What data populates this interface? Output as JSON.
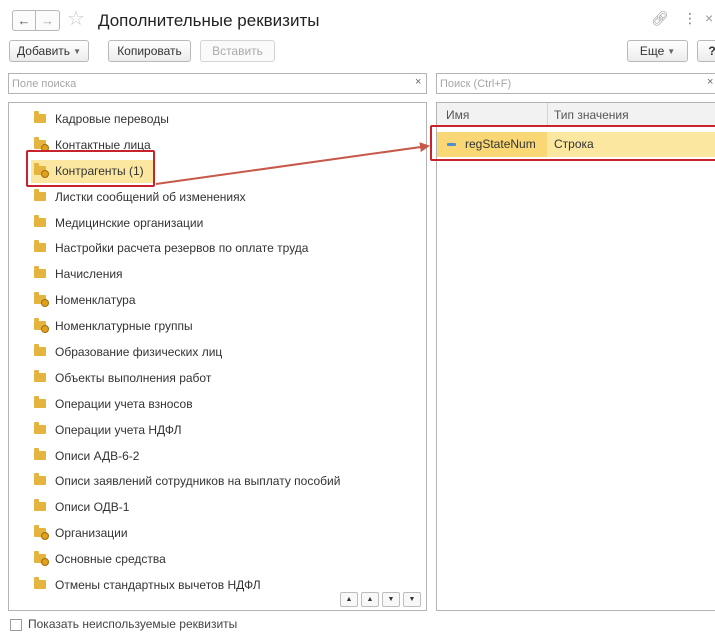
{
  "window": {
    "title": "Дополнительные реквизиты",
    "back_glyph": "←",
    "forward_glyph": "→",
    "icons": [
      "star-icon",
      "link-icon",
      "more-icon",
      "close-icon"
    ]
  },
  "toolbar": {
    "add_label": "Добавить",
    "copy_label": "Копировать",
    "paste_label": "Вставить",
    "more_label": "Еще",
    "help_label": "?"
  },
  "search_left": {
    "placeholder": "Поле поиска"
  },
  "search_right": {
    "placeholder": "Поиск (Ctrl+F)"
  },
  "tree": {
    "items": [
      {
        "label": "Кадровые переводы",
        "badge": false
      },
      {
        "label": "Контактные лица",
        "badge": true
      },
      {
        "label": "Контрагенты (1)",
        "badge": true,
        "selected": true
      },
      {
        "label": "Листки сообщений об изменениях",
        "badge": false
      },
      {
        "label": "Медицинские организации",
        "badge": false
      },
      {
        "label": "Настройки расчета резервов по оплате труда",
        "badge": false
      },
      {
        "label": "Начисления",
        "badge": false
      },
      {
        "label": "Номенклатура",
        "badge": true
      },
      {
        "label": "Номенклатурные группы",
        "badge": true
      },
      {
        "label": "Образование физических лиц",
        "badge": false
      },
      {
        "label": "Объекты выполнения работ",
        "badge": false
      },
      {
        "label": "Операции учета взносов",
        "badge": false
      },
      {
        "label": "Операции учета НДФЛ",
        "badge": false
      },
      {
        "label": "Описи АДВ-6-2",
        "badge": false
      },
      {
        "label": "Описи заявлений сотрудников на выплату пособий",
        "badge": false
      },
      {
        "label": "Описи ОДВ-1",
        "badge": false
      },
      {
        "label": "Организации",
        "badge": true
      },
      {
        "label": "Основные средства",
        "badge": true
      },
      {
        "label": "Отмены стандартных вычетов НДФЛ",
        "badge": false
      }
    ]
  },
  "props": {
    "columns": {
      "name": "Имя",
      "type": "Тип значения"
    },
    "rows": [
      {
        "name": "regStateNum",
        "type": "Строка"
      }
    ]
  },
  "footer": {
    "show_unused_label": "Показать неиспользуемые реквизиты",
    "checked": false
  },
  "colors": {
    "highlight": "#c8232c",
    "selection": "#fbe7a0",
    "folder": "#e5b43f"
  }
}
